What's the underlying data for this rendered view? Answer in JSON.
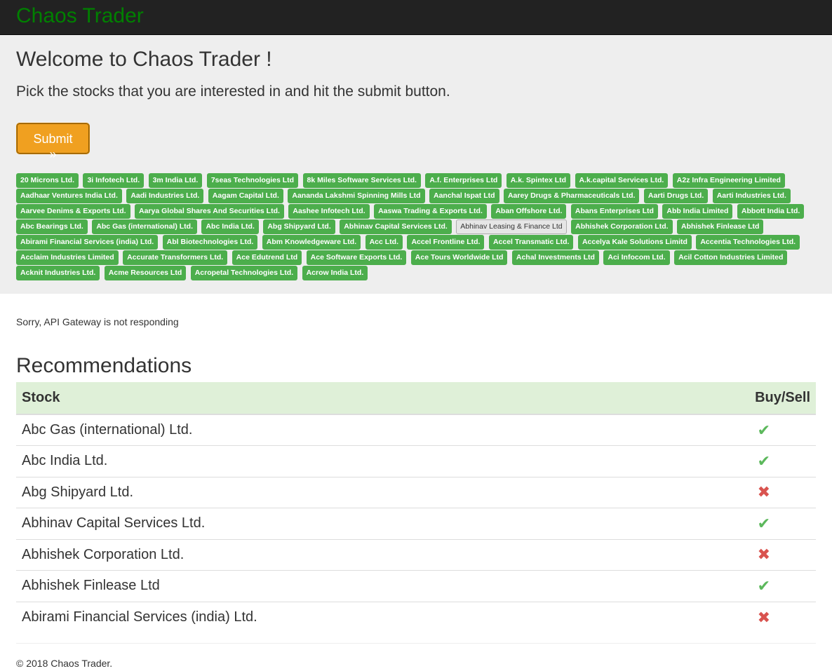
{
  "navbar": {
    "brand": "Chaos Trader"
  },
  "jumbotron": {
    "title": "Welcome to Chaos Trader !",
    "lead": "Pick the stocks that you are interested in and hit the submit button.",
    "submit_label": "Submit »"
  },
  "stocks": [
    "20 Microns Ltd.",
    "3i Infotech Ltd.",
    "3m India Ltd.",
    "7seas Technologies Ltd",
    "8k Miles Software Services Ltd.",
    "A.f. Enterprises Ltd",
    "A.k. Spintex Ltd",
    "A.k.capital Services Ltd.",
    "A2z Infra Engineering Limited",
    "Aadhaar Ventures India Ltd.",
    "Aadi Industries Ltd.",
    "Aagam Capital Ltd.",
    "Aananda Lakshmi Spinning Mills Ltd",
    "Aanchal Ispat Ltd",
    "Aarey Drugs & Pharmaceuticals Ltd.",
    "Aarti Drugs Ltd.",
    "Aarti Industries Ltd.",
    "Aarvee Denims & Exports Ltd.",
    "Aarya Global Shares And Securities Ltd.",
    "Aashee Infotech Ltd.",
    "Aaswa Trading & Exports Ltd.",
    "Aban Offshore Ltd.",
    "Abans Enterprises Ltd",
    "Abb India Limited",
    "Abbott India Ltd.",
    "Abc Bearings Ltd.",
    "Abc Gas (international) Ltd.",
    "Abc India Ltd.",
    "Abg Shipyard Ltd.",
    "Abhinav Capital Services Ltd.",
    "Abhinav Leasing & Finance Ltd",
    "Abhishek Corporation Ltd.",
    "Abhishek Finlease Ltd",
    "Abirami Financial Services (india) Ltd.",
    "Abl Biotechnologies Ltd.",
    "Abm Knowledgeware Ltd.",
    "Acc Ltd.",
    "Accel Frontline Ltd.",
    "Accel Transmatic Ltd.",
    "Accelya Kale Solutions Limitd",
    "Accentia Technologies Ltd.",
    "Acclaim Industries Limited",
    "Accurate Transformers Ltd.",
    "Ace Edutrend Ltd",
    "Ace Software Exports Ltd.",
    "Ace Tours Worldwide Ltd",
    "Achal Investments Ltd",
    "Aci Infocom Ltd.",
    "Acil Cotton Industries Limited",
    "Acknit Industries Ltd.",
    "Acme Resources Ltd",
    "Acropetal Technologies Ltd.",
    "Acrow India Ltd."
  ],
  "selected_stock": "Abhinav Leasing & Finance Ltd",
  "error_message": "Sorry, API Gateway is not responding",
  "recommendations": {
    "title": "Recommendations",
    "headers": {
      "stock": "Stock",
      "signal": "Buy/Sell"
    },
    "rows": [
      {
        "stock": "Abc Gas (international) Ltd.",
        "signal": "buy"
      },
      {
        "stock": "Abc India Ltd.",
        "signal": "buy"
      },
      {
        "stock": "Abg Shipyard Ltd.",
        "signal": "sell"
      },
      {
        "stock": "Abhinav Capital Services Ltd.",
        "signal": "buy"
      },
      {
        "stock": "Abhishek Corporation Ltd.",
        "signal": "sell"
      },
      {
        "stock": "Abhishek Finlease Ltd",
        "signal": "buy"
      },
      {
        "stock": "Abirami Financial Services (india) Ltd.",
        "signal": "sell"
      }
    ]
  },
  "icons": {
    "buy": "check-icon",
    "sell": "cross-icon"
  },
  "colors": {
    "brand": "#008000",
    "tag": "#4cae4c",
    "buy": "#5cb85c",
    "sell": "#d9534f",
    "submit": "#f0a020"
  },
  "footer": "© 2018 Chaos Trader."
}
